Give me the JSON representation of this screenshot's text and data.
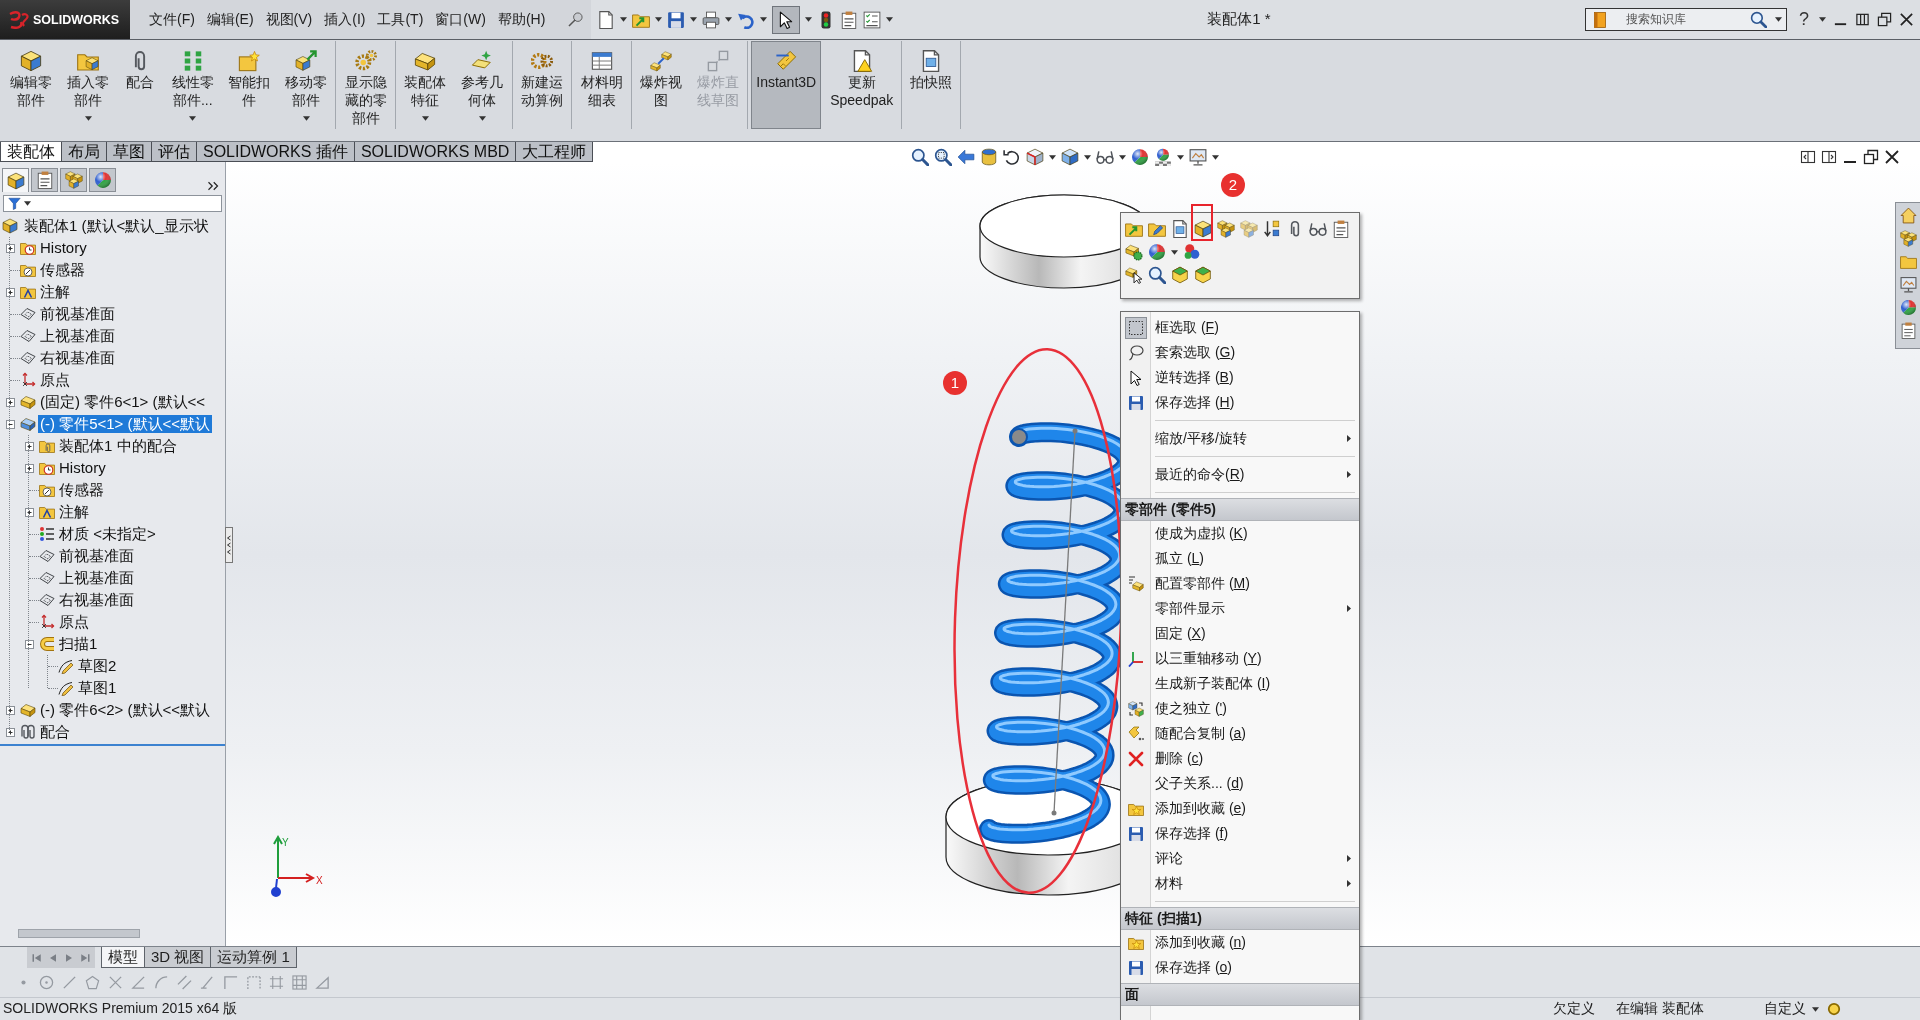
{
  "app": {
    "logo_text": "SOLIDWORKS",
    "menu_bar": [
      "文件(F)",
      "编辑(E)",
      "视图(V)",
      "插入(I)",
      "工具(T)",
      "窗口(W)",
      "帮助(H)"
    ],
    "quick_access": [
      {
        "pressed": false
      },
      {
        "pressed": false
      },
      {
        "pressed": false
      },
      {
        "pressed": false
      },
      {
        "pressed": false
      },
      {
        "pressed": true
      },
      {
        "pressed": false
      },
      {
        "pressed": false
      },
      {
        "pressed": false
      }
    ],
    "document_title": "装配体1 *",
    "search": {
      "placeholder": "搜索知识库"
    },
    "help": "?"
  },
  "ribbon": {
    "groups": [
      {
        "buttons": [
          {
            "label": "编辑零部件",
            "dropdown": false,
            "disabled": false,
            "pressed": false
          },
          {
            "label": "插入零部件",
            "dropdown": true,
            "disabled": false,
            "pressed": false
          },
          {
            "label": "配合",
            "dropdown": false,
            "disabled": false,
            "pressed": false
          },
          {
            "label": "线性零部件...",
            "dropdown": true,
            "disabled": false,
            "pressed": false
          },
          {
            "label": "智能扣件",
            "dropdown": false,
            "disabled": false,
            "pressed": false
          },
          {
            "label": "移动零部件",
            "dropdown": true,
            "disabled": false,
            "pressed": false
          }
        ]
      },
      {
        "buttons": [
          {
            "label": "显示隐藏的零部件",
            "dropdown": false,
            "disabled": false,
            "pressed": false
          }
        ]
      },
      {
        "buttons": [
          {
            "label": "装配体特征",
            "dropdown": true,
            "disabled": false,
            "pressed": false
          },
          {
            "label": "参考几何体",
            "dropdown": true,
            "disabled": false,
            "pressed": false
          }
        ]
      },
      {
        "buttons": [
          {
            "label": "新建运动算例",
            "dropdown": false,
            "disabled": false,
            "pressed": false
          }
        ]
      },
      {
        "buttons": [
          {
            "label": "材料明细表",
            "dropdown": false,
            "disabled": false,
            "pressed": false
          }
        ]
      },
      {
        "buttons": [
          {
            "label": "爆炸视图",
            "dropdown": false,
            "disabled": false,
            "pressed": false
          },
          {
            "label": "爆炸直线草图",
            "dropdown": false,
            "disabled": true,
            "pressed": false
          }
        ]
      },
      {
        "buttons": [
          {
            "label": "Instant3D",
            "dropdown": false,
            "disabled": false,
            "pressed": true
          },
          {
            "label": "更新 Speedpak",
            "dropdown": false,
            "disabled": false,
            "pressed": false
          }
        ]
      },
      {
        "buttons": [
          {
            "label": "拍快照",
            "dropdown": false,
            "disabled": false,
            "pressed": false
          }
        ]
      }
    ]
  },
  "command_tabs": [
    {
      "label": "装配体",
      "selected": true
    },
    {
      "label": "布局",
      "selected": false
    },
    {
      "label": "草图",
      "selected": false
    },
    {
      "label": "评估",
      "selected": false
    },
    {
      "label": "SOLIDWORKS 插件",
      "selected": false
    },
    {
      "label": "SOLIDWORKS MBD",
      "selected": false
    },
    {
      "label": "大工程师",
      "selected": false
    }
  ],
  "feature_manager": {
    "tabs": [
      {
        "selected": true
      },
      {
        "selected": false
      },
      {
        "selected": false
      },
      {
        "selected": false
      }
    ],
    "tree": [
      {
        "kind": "assembly",
        "label": "装配体1 (默认<默认_显示状",
        "selected": false,
        "children": [
          {
            "kind": "history",
            "label": "History",
            "expanded": false,
            "selected": false
          },
          {
            "kind": "sensors",
            "label": "传感器",
            "selected": false
          },
          {
            "kind": "annotations",
            "label": "注解",
            "expanded": false,
            "selected": false
          },
          {
            "kind": "plane",
            "label": "前视基准面",
            "selected": false
          },
          {
            "kind": "plane",
            "label": "上视基准面",
            "selected": false
          },
          {
            "kind": "plane",
            "label": "右视基准面",
            "selected": false
          },
          {
            "kind": "origin",
            "label": "原点",
            "selected": false
          },
          {
            "kind": "part",
            "label": "(固定) 零件6<1> (默认<<",
            "expanded": false,
            "selected": false
          },
          {
            "kind": "part",
            "label": "(-) 零件5<1> (默认<<默认",
            "expanded": true,
            "selected": true,
            "children": [
              {
                "kind": "mates-folder",
                "label": "装配体1 中的配合",
                "expanded": false,
                "selected": false
              },
              {
                "kind": "history",
                "label": "History",
                "expanded": false,
                "selected": false
              },
              {
                "kind": "sensors",
                "label": "传感器",
                "selected": false
              },
              {
                "kind": "annotations",
                "label": "注解",
                "expanded": false,
                "selected": false
              },
              {
                "kind": "material",
                "label": "材质 <未指定>",
                "selected": false
              },
              {
                "kind": "plane",
                "label": "前视基准面",
                "selected": false
              },
              {
                "kind": "plane",
                "label": "上视基准面",
                "selected": false
              },
              {
                "kind": "plane",
                "label": "右视基准面",
                "selected": false
              },
              {
                "kind": "origin",
                "label": "原点",
                "selected": false
              },
              {
                "kind": "sweep",
                "label": "扫描1",
                "expanded": true,
                "selected": false,
                "children": [
                  {
                    "kind": "sketch",
                    "label": "草图2",
                    "selected": false
                  },
                  {
                    "kind": "sketch",
                    "label": "草图1",
                    "selected": false
                  }
                ]
              }
            ]
          },
          {
            "kind": "part",
            "label": "(-) 零件6<2> (默认<<默认",
            "expanded": false,
            "selected": false
          },
          {
            "kind": "mates",
            "label": "配合",
            "expanded": false,
            "selected": false
          }
        ]
      }
    ]
  },
  "graphics": {
    "triad": {
      "x_label": "X",
      "y_label": "Y"
    },
    "annotations": [
      {
        "kind": "ellipse"
      },
      {
        "kind": "badge",
        "label": "1"
      },
      {
        "kind": "box"
      },
      {
        "kind": "badge",
        "label": "2"
      }
    ]
  },
  "context_menu": {
    "groups": [
      {
        "items": [
          {
            "label": "框选取 (",
            "mnemonic": "F",
            "label_end": ")",
            "checked": true,
            "submenu": false
          },
          {
            "label": "套索选取 (",
            "mnemonic": "G",
            "label_end": ")",
            "checked": false,
            "submenu": false
          },
          {
            "label": "逆转选择 (",
            "mnemonic": "B",
            "label_end": ")",
            "checked": false,
            "submenu": false
          },
          {
            "label": "保存选择 (",
            "mnemonic": "H",
            "label_end": ")",
            "checked": false,
            "submenu": false
          }
        ]
      },
      {
        "items": [
          {
            "label": "缩放/平移/旋转",
            "submenu": true
          }
        ]
      },
      {
        "items": [
          {
            "label": "最近的命令(",
            "mnemonic": "R",
            "label_end": ")",
            "submenu": true
          }
        ]
      },
      {
        "header": "零部件 (零件5)",
        "items": [
          {
            "label": "使成为虚拟 (",
            "mnemonic": "K",
            "label_end": ")",
            "submenu": false
          },
          {
            "label": "孤立 (",
            "mnemonic": "L",
            "label_end": ")",
            "submenu": false
          },
          {
            "label": "配置零部件 (",
            "mnemonic": "M",
            "label_end": ")",
            "submenu": false
          },
          {
            "label": "零部件显示",
            "submenu": true
          },
          {
            "label": "固定 (",
            "mnemonic": "X",
            "label_end": ")",
            "submenu": false
          },
          {
            "label": "以三重轴移动 (",
            "mnemonic": "Y",
            "label_end": ")",
            "submenu": false
          },
          {
            "label": "生成新子装配体 (",
            "mnemonic": "I",
            "label_end": ")",
            "submenu": false
          },
          {
            "label": "使之独立 (",
            "mnemonic": "'",
            "label_end": ")",
            "submenu": false
          },
          {
            "label": "随配合复制 (",
            "mnemonic": "a",
            "label_end": ")",
            "submenu": false
          },
          {
            "label": "删除 (",
            "mnemonic": "c",
            "label_end": ")",
            "submenu": false
          },
          {
            "label": "父子关系... (",
            "mnemonic": "d",
            "label_end": ")",
            "submenu": false
          },
          {
            "label": "添加到收藏 (",
            "mnemonic": "e",
            "label_end": ")",
            "submenu": false
          },
          {
            "label": "保存选择 (",
            "mnemonic": "f",
            "label_end": ")",
            "submenu": false
          },
          {
            "label": "评论",
            "submenu": true
          },
          {
            "label": "材料",
            "submenu": true
          }
        ]
      },
      {
        "header": "特征 (扫描1)",
        "items": [
          {
            "label": "添加到收藏 (",
            "mnemonic": "n",
            "label_end": ")",
            "submenu": false
          },
          {
            "label": "保存选择 (",
            "mnemonic": "o",
            "label_end": ")",
            "submenu": false
          }
        ]
      },
      {
        "header": "面"
      }
    ]
  },
  "bottom_tabs": [
    {
      "label": "模型",
      "selected": true
    },
    {
      "label": "3D 视图",
      "selected": false
    },
    {
      "label": "运动算例 1",
      "selected": false
    }
  ],
  "status_bar": {
    "product": "SOLIDWORKS Premium 2015 x64 版",
    "fields": [
      {
        "label": "欠定义",
        "dropdown": false
      },
      {
        "label": "在编辑 装配体",
        "dropdown": false
      },
      {
        "label": "自定义",
        "dropdown": true
      }
    ]
  }
}
